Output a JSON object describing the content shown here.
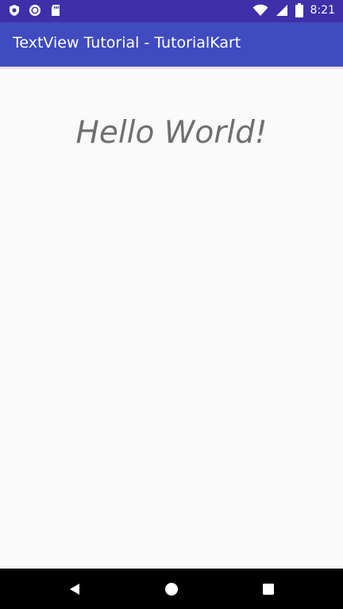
{
  "status_bar": {
    "time": "8:21",
    "left_icons": [
      "shield-icon",
      "vpn-icon",
      "sd-card-icon"
    ],
    "right_icons": [
      "wifi-icon",
      "signal-icon",
      "battery-icon"
    ],
    "color": "#3f2fa8"
  },
  "app_bar": {
    "title": "TextView Tutorial - TutorialKart",
    "color": "#3f4bbf"
  },
  "content": {
    "text": "Hello World!",
    "text_color": "#6f6f6f"
  },
  "nav_bar": {
    "buttons": [
      "back-icon",
      "home-icon",
      "recents-icon"
    ]
  }
}
